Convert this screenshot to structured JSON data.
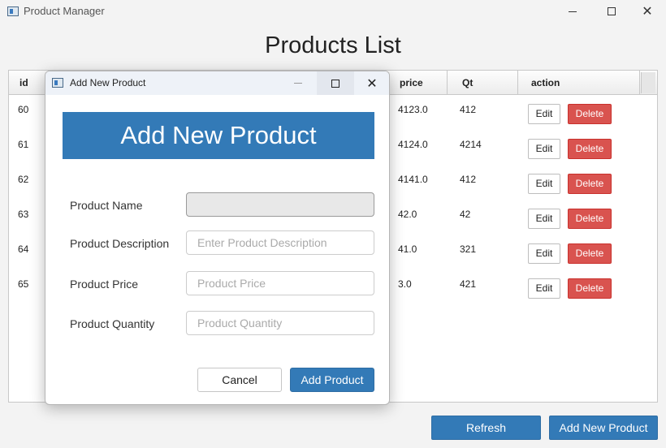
{
  "window": {
    "title": "Product Manager",
    "minimize_icon": "minimize-icon",
    "maximize_icon": "maximize-icon",
    "close_glyph": "✕"
  },
  "page": {
    "title": "Products List"
  },
  "table": {
    "columns": {
      "id": "id",
      "price": "price",
      "qt": "Qt",
      "action": "action"
    },
    "rows": [
      {
        "id": "60",
        "price": "4123.0",
        "qt": "412"
      },
      {
        "id": "61",
        "price": "4124.0",
        "qt": "4214"
      },
      {
        "id": "62",
        "price": "4141.0",
        "qt": "412"
      },
      {
        "id": "63",
        "price": "42.0",
        "qt": "42"
      },
      {
        "id": "64",
        "price": "41.0",
        "qt": "321"
      },
      {
        "id": "65",
        "price": "3.0",
        "qt": "421"
      }
    ],
    "edit_label": "Edit",
    "delete_label": "Delete"
  },
  "bottom": {
    "refresh_label": "Refresh",
    "add_new_label": "Add New Product"
  },
  "dialog": {
    "title": "Add New Product",
    "banner": "Add New Product",
    "fields": {
      "name_label": "Product Name",
      "name_value": "",
      "description_label": "Product Description",
      "description_placeholder": "Enter Product Description",
      "price_label": "Product Price",
      "price_placeholder": "Product Price",
      "quantity_label": "Product Quantity",
      "quantity_placeholder": "Product Quantity"
    },
    "cancel_label": "Cancel",
    "add_label": "Add Product"
  },
  "colors": {
    "primary": "#337ab7",
    "danger": "#d9534f"
  }
}
